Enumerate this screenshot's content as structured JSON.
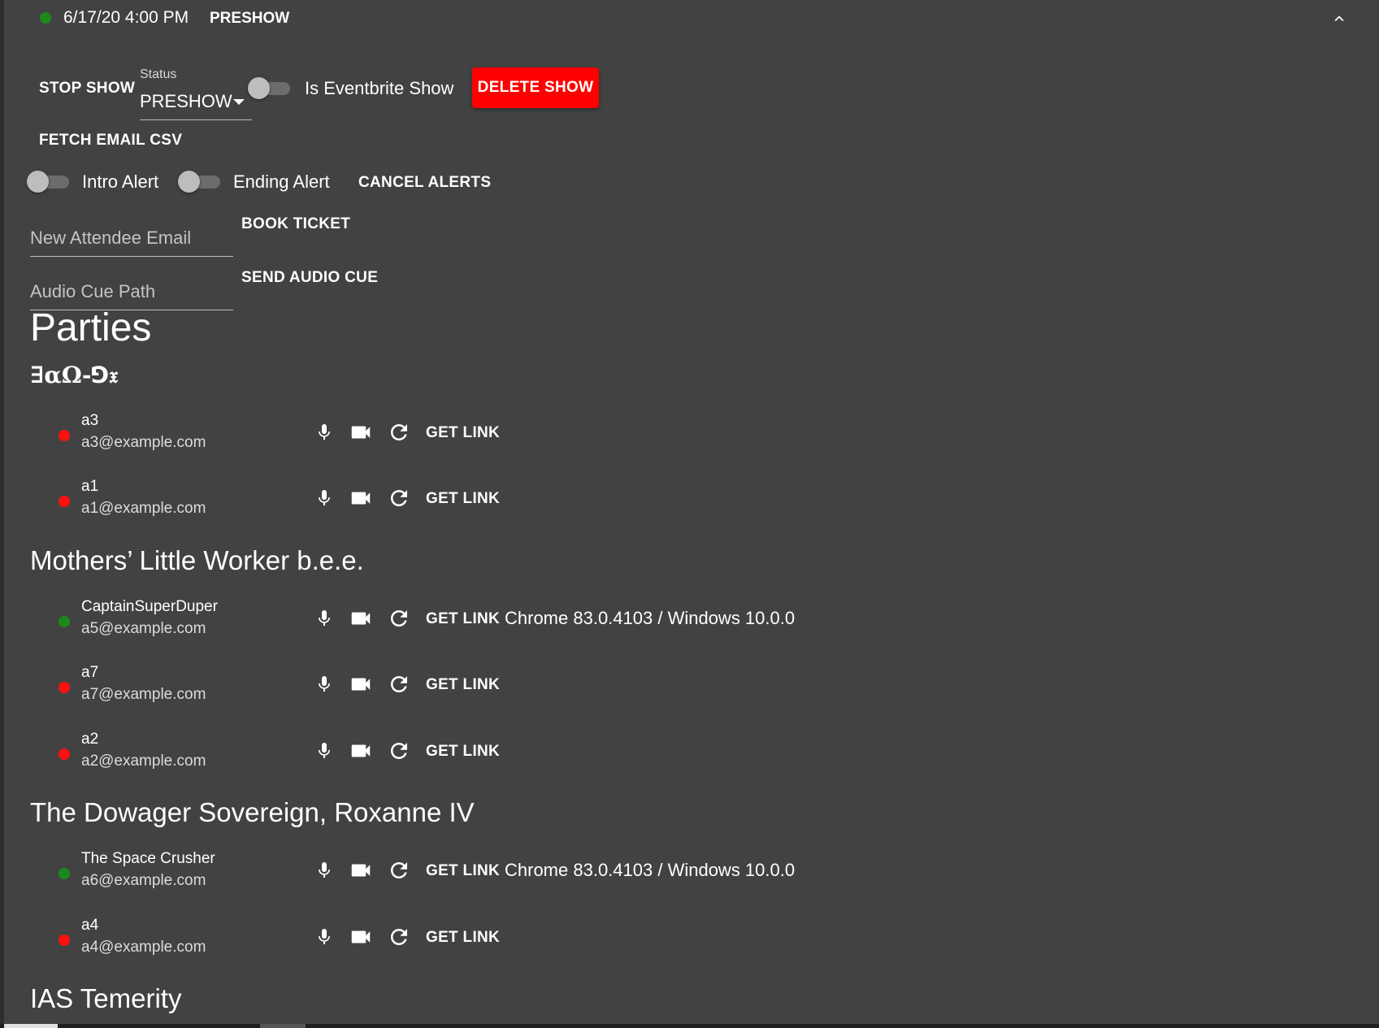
{
  "header": {
    "datetime": "6/17/20 4:00 PM",
    "status": "PRESHOW",
    "status_color": "#1b8a1b"
  },
  "controls": {
    "stop_show": "STOP SHOW",
    "status_select": {
      "label": "Status",
      "value": "PRESHOW"
    },
    "eventbrite_toggle": {
      "label": "Is Eventbrite Show",
      "checked": false
    },
    "delete_show": "DELETE SHOW",
    "fetch_email_csv": "FETCH EMAIL CSV",
    "intro_alert": {
      "label": "Intro Alert",
      "checked": false
    },
    "ending_alert": {
      "label": "Ending Alert",
      "checked": false
    },
    "cancel_alerts": "CANCEL ALERTS",
    "new_attendee_email": {
      "placeholder": "New Attendee Email",
      "value": ""
    },
    "book_ticket": "BOOK TICKET",
    "audio_cue_path": {
      "placeholder": "Audio Cue Path",
      "value": ""
    },
    "send_audio_cue": "SEND AUDIO CUE"
  },
  "parties": {
    "title": "Parties",
    "groups": [
      {
        "name": "∃αΩ-⅁𝔵",
        "attendees": [
          {
            "name": "a3",
            "email": "a3@example.com",
            "online": false,
            "get_link": "GET LINK",
            "browser": ""
          },
          {
            "name": "a1",
            "email": "a1@example.com",
            "online": false,
            "get_link": "GET LINK",
            "browser": ""
          }
        ]
      },
      {
        "name": "Mothers’ Little Worker b.e.e.",
        "attendees": [
          {
            "name": "CaptainSuperDuper",
            "email": "a5@example.com",
            "online": true,
            "get_link": "GET LINK",
            "browser": "Chrome 83.0.4103 / Windows 10.0.0"
          },
          {
            "name": "a7",
            "email": "a7@example.com",
            "online": false,
            "get_link": "GET LINK",
            "browser": ""
          },
          {
            "name": "a2",
            "email": "a2@example.com",
            "online": false,
            "get_link": "GET LINK",
            "browser": ""
          }
        ]
      },
      {
        "name": "The Dowager Sovereign, Roxanne IV",
        "attendees": [
          {
            "name": "The Space Crusher",
            "email": "a6@example.com",
            "online": true,
            "get_link": "GET LINK",
            "browser": "Chrome 83.0.4103 / Windows 10.0.0"
          },
          {
            "name": "a4",
            "email": "a4@example.com",
            "online": false,
            "get_link": "GET LINK",
            "browser": ""
          }
        ]
      },
      {
        "name": "IAS Temerity",
        "attendees": []
      }
    ]
  },
  "icons": {
    "status_online": "green-dot-icon",
    "status_offline": "red-dot-icon",
    "mic": "microphone-icon",
    "camera": "video-camera-icon",
    "refresh": "refresh-icon",
    "collapse": "chevron-up-icon"
  },
  "colors": {
    "background": "#424242",
    "online": "#1b8a1b",
    "offline": "#ff1010",
    "danger": "#ff0000"
  }
}
